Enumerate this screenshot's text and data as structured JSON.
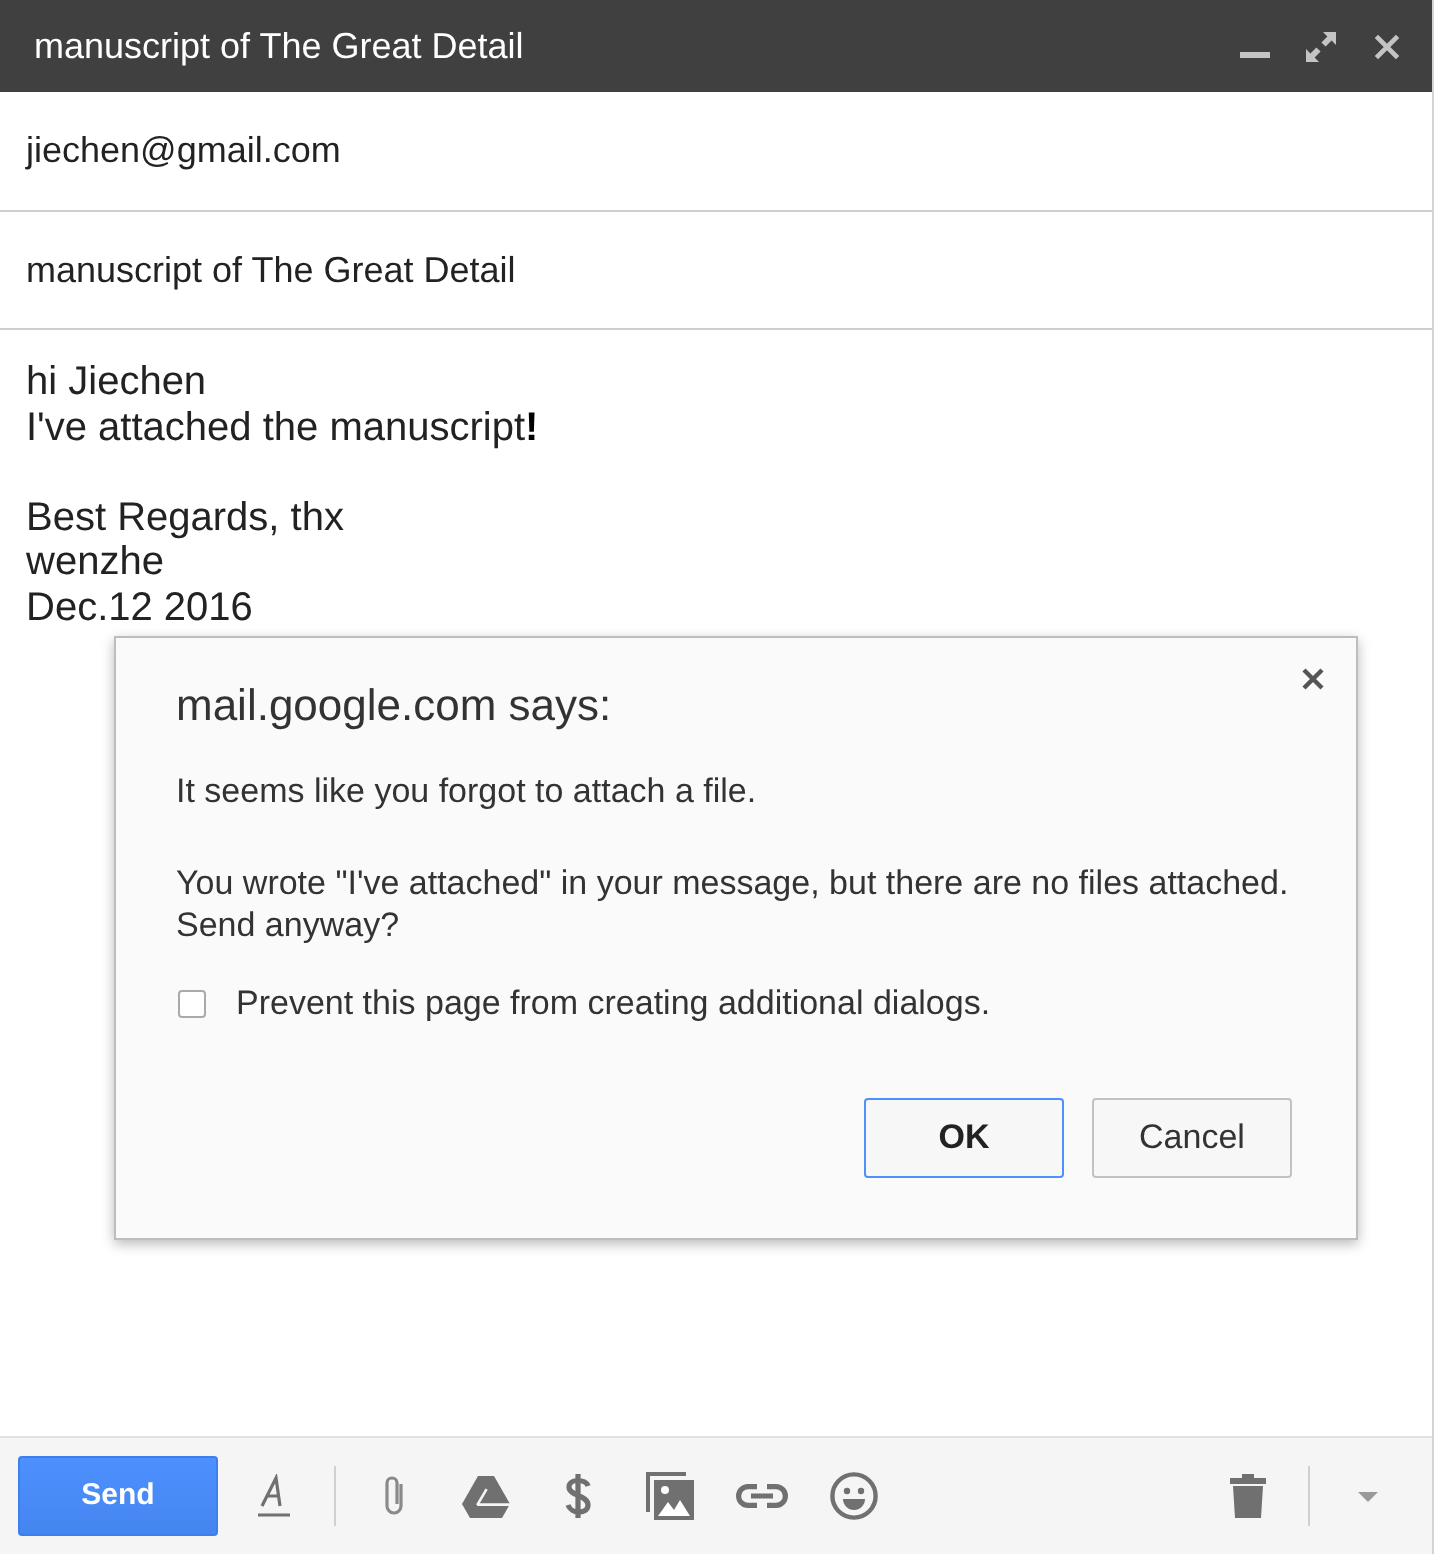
{
  "window": {
    "title": "manuscript of The Great Detail"
  },
  "compose": {
    "to": "jiechen@gmail.com",
    "subject": "manuscript of The Great Detail",
    "body": [
      [
        "hi Jiechen",
        "I've attached the manuscript**!**"
      ],
      [
        "Best Regards, thx",
        "wenzhe",
        "Dec.12 2016"
      ]
    ]
  },
  "toolbar": {
    "send": "Send"
  },
  "dialog": {
    "title": "mail.google.com says:",
    "messages": [
      "It seems like you forgot to attach a file.",
      "You wrote \"I've attached\" in your message, but there are no files attached. Send anyway?"
    ],
    "checkbox": {
      "label": "Prevent this page from creating additional dialogs.",
      "checked": false
    },
    "buttons": [
      {
        "label": "OK",
        "default": true
      },
      {
        "label": "Cancel",
        "default": false
      }
    ]
  }
}
